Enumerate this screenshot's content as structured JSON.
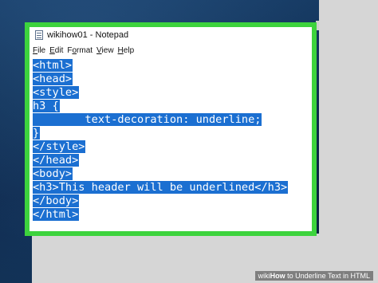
{
  "window": {
    "title": "wikihow01 - Notepad"
  },
  "menu": [
    {
      "u": "F",
      "rest": "ile"
    },
    {
      "u": "E",
      "rest": "dit"
    },
    {
      "u": "",
      "rest": "F",
      "tail": "ormat",
      "mid": "o"
    },
    {
      "u": "V",
      "rest": "iew"
    },
    {
      "u": "H",
      "rest": "elp"
    }
  ],
  "menu_labels": [
    "File",
    "Edit",
    "Format",
    "View",
    "Help"
  ],
  "code_lines": [
    "<html>",
    "<head>",
    "<style>",
    "h3 {",
    "        text-decoration: underline;",
    "}",
    "</style>",
    "</head>",
    "<body>",
    "<h3>This header will be underlined</h3>",
    "</body>",
    "</html>"
  ],
  "watermark": {
    "brand": "wiki",
    "how": "How",
    "text": " to Underline Text in HTML"
  },
  "colors": {
    "frame_highlight": "#3dd33d",
    "selection": "#1b6fd1"
  }
}
